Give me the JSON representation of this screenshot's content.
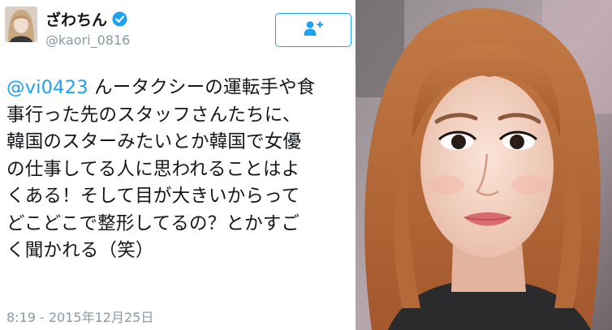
{
  "tweet": {
    "display_name": "ざわちん",
    "handle": "@kaori_0816",
    "mention": "@vi0423",
    "lines": [
      "んータクシーの運転手や食",
      "事行った先のスタッフさんたちに、",
      "韓国のスターみたいとか韓国で女優",
      "の仕事してる人に思われることはよ",
      "くある！そして目が大きいからって",
      "どこどこで整形してるの？とかすご",
      "く聞かれる（笑）"
    ],
    "timestamp": "8:19 - 2015年12月25日",
    "icons": {
      "verified": "verified-badge-icon",
      "follow": "add-user-icon"
    }
  },
  "colors": {
    "accent": "#1da1f2",
    "text": "#14171a",
    "muted": "#8899a6"
  },
  "photo": {
    "subject": "portrait-photo"
  }
}
